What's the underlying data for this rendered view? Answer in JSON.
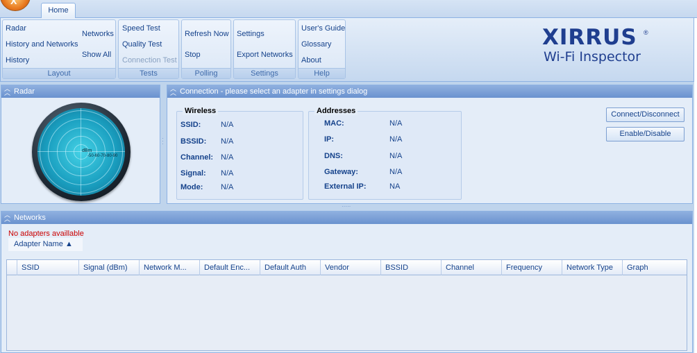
{
  "app": {
    "orb_glyph": "X",
    "home_tab": "Home"
  },
  "ribbon": {
    "layout": {
      "label": "Layout",
      "radar": "Radar",
      "history_networks": "History and Networks",
      "history": "History",
      "networks": "Networks",
      "show_all": "Show All"
    },
    "tests": {
      "label": "Tests",
      "speed_test": "Speed Test",
      "quality_test": "Quality Test",
      "connection_test": "Connection Test"
    },
    "polling": {
      "label": "Polling",
      "refresh_now": "Refresh Now",
      "stop": "Stop"
    },
    "settings": {
      "label": "Settings",
      "settings": "Settings",
      "export_networks": "Export Networks"
    },
    "help": {
      "label": "Help",
      "users_guide": "User's Guide",
      "glossary": "Glossary",
      "about": "About"
    }
  },
  "logo": {
    "main": "XIRRUS",
    "reg": "®",
    "sub": "Wi-Fi Inspector"
  },
  "radar_panel": {
    "title": "Radar",
    "unit": "dBm",
    "scale": "-50-60-70-80-90"
  },
  "connection_panel": {
    "title": "Connection - please select an adapter in settings dialog",
    "wireless": {
      "title": "Wireless",
      "fields": [
        {
          "label": "SSID:",
          "value": "N/A"
        },
        {
          "label": "BSSID:",
          "value": "N/A"
        },
        {
          "label": "Channel:",
          "value": "N/A"
        },
        {
          "label": "Signal:",
          "value": "N/A"
        },
        {
          "label": "Mode:",
          "value": "N/A"
        }
      ]
    },
    "addresses": {
      "title": "Addresses",
      "fields": [
        {
          "label": "MAC:",
          "value": "N/A"
        },
        {
          "label": "IP:",
          "value": "N/A"
        },
        {
          "label": "DNS:",
          "value": "N/A"
        },
        {
          "label": "Gateway:",
          "value": "N/A"
        },
        {
          "label": "External IP:",
          "value": "NA"
        }
      ]
    },
    "connect_button": "Connect/Disconnect",
    "enable_button": "Enable/Disable"
  },
  "networks_panel": {
    "title": "Networks",
    "status": "No adapters availlable",
    "adapter_column": "Adapter Name ▲",
    "columns": [
      "SSID",
      "Signal (dBm)",
      "Network M...",
      "Default Enc...",
      "Default Auth",
      "Vendor",
      "BSSID",
      "Channel",
      "Frequency",
      "Network Type",
      "Graph"
    ]
  }
}
